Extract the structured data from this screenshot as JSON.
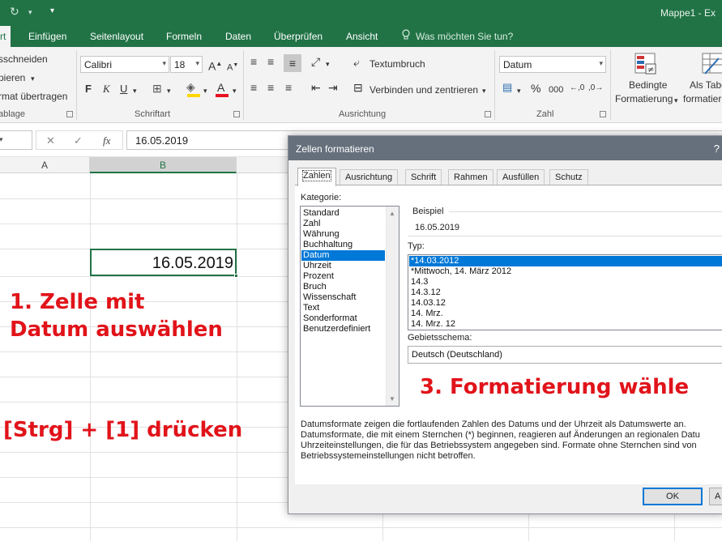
{
  "app": {
    "window_title": "Mappe1 - Ex"
  },
  "tabs": [
    {
      "id": "start",
      "label": "rt",
      "active": true
    },
    {
      "id": "einfuegen",
      "label": "Einfügen"
    },
    {
      "id": "seitenlayout",
      "label": "Seitenlayout"
    },
    {
      "id": "formeln",
      "label": "Formeln"
    },
    {
      "id": "daten",
      "label": "Daten"
    },
    {
      "id": "ueberpruefen",
      "label": "Überprüfen"
    },
    {
      "id": "ansicht",
      "label": "Ansicht"
    }
  ],
  "tellme": {
    "placeholder": "Was möchten Sie tun?"
  },
  "ribbon": {
    "clipboard": {
      "cut": "sschneiden",
      "copy": "pieren",
      "format_painter": "rmat übertragen",
      "label": "ablage"
    },
    "font": {
      "name": "Calibri",
      "size": "18",
      "grow": "A",
      "shrink": "A",
      "bold": "F",
      "italic": "K",
      "underline": "U",
      "label": "Schriftart",
      "font_color": "#e81123",
      "fill_color": "#ffd700"
    },
    "alignment": {
      "wrap": "Textumbruch",
      "merge": "Verbinden und zentrieren",
      "label": "Ausrichtung"
    },
    "number": {
      "format": "Datum",
      "percent": "%",
      "thousands": "000",
      "label": "Zahl"
    },
    "styles": {
      "conditional_line1": "Bedingte",
      "conditional_line2": "Formatierung",
      "table_line1": "Als Tabe",
      "table_line2": "formatier"
    }
  },
  "formula_bar": {
    "cancel": "✕",
    "enter": "✓",
    "fx": "fx",
    "value": "16.05.2019"
  },
  "grid": {
    "columns": [
      "A",
      "B"
    ],
    "selected_cell_value": "16.05.2019"
  },
  "annotations": {
    "step1_line1": "1. Zelle mit",
    "step1_line2": "Datum auswählen",
    "step2": "[Strg] + [1] drücken",
    "step3": "3. Formatierung wähle"
  },
  "dialog": {
    "title": "Zellen formatieren",
    "help": "?",
    "tabs": [
      "Zahlen",
      "Ausrichtung",
      "Schrift",
      "Rahmen",
      "Ausfüllen",
      "Schutz"
    ],
    "category_label": "Kategorie:",
    "categories": [
      "Standard",
      "Zahl",
      "Währung",
      "Buchhaltung",
      "Datum",
      "Uhrzeit",
      "Prozent",
      "Bruch",
      "Wissenschaft",
      "Text",
      "Sonderformat",
      "Benutzerdefiniert"
    ],
    "selected_category": "Datum",
    "sample_label": "Beispiel",
    "sample_value": "16.05.2019",
    "type_label": "Typ:",
    "types": [
      "*14.03.2012",
      "*Mittwoch, 14. März 2012",
      "14.3",
      "14.3.12",
      "14.03.12",
      "14. Mrz.",
      "14. Mrz. 12"
    ],
    "locale_label": "Gebietsschema:",
    "locale_value": "Deutsch (Deutschland)",
    "description": [
      "Datumsformate zeigen die fortlaufenden Zahlen des Datums und der Uhrzeit als Datumswerte an.",
      "Datumsformate, die mit einem Sternchen (*) beginnen, reagieren auf Änderungen an regionalen Datu",
      "Uhrzeiteinstellungen, die für das Betriebssystem angegeben sind. Formate ohne Sternchen sind von",
      "Betriebssystemeinstellungen nicht betroffen."
    ],
    "ok_label": "OK",
    "cancel_label": "A"
  }
}
